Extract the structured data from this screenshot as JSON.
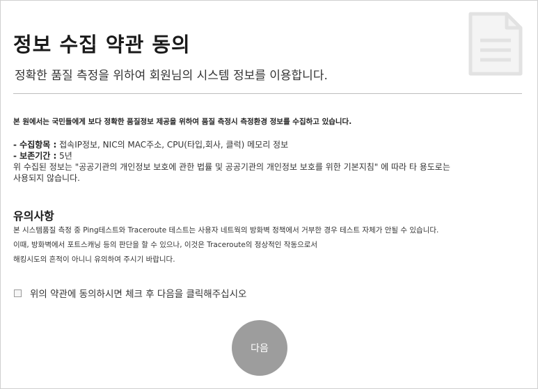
{
  "header": {
    "title": "정보 수집 약관 동의",
    "subtitle": "정확한 품질 측정을 위하여 회원님의 시스템 정보를 이용합니다."
  },
  "icons": {
    "document": "document-icon"
  },
  "intro": "본 원에서는 국민들에게 보다 정확한 품질정보 제공을 위하여 품질 측정시 측정환경 정보를 수집하고 있습니다.",
  "info": {
    "items_label": "- 수집항목 :",
    "items_value": " 접속IP정보, NIC의 MAC주소, CPU(타입,회사, 클럭) 메모리 정보",
    "period_label": "- 보존기간 :",
    "period_value": " 5년",
    "usage_line1": "위 수집된 정보는 \"공공기관의 개인정보 보호에 관한 법률 및 공공기관의 개인정보 보호를 위한 기본지침\" 에 따라 타 용도로는",
    "usage_line2": "사용되지 않습니다."
  },
  "caution": {
    "title": "유의사항",
    "line1": "본 시스템품질 측정 중 Ping테스트와 Traceroute 테스트는 사용자 네트웍의 방화벽 정책에서 거부한 경우 테스트 자체가 안될 수 있습니다.",
    "line2": "이때, 방화벽에서 포트스캐닝 등의 판단을 할 수 있으나, 이것은 Traceroute의 정상적인 작동으로서",
    "line3": "해킹시도의 흔적이 아니니 유의하여 주시기 바랍니다."
  },
  "agreement": {
    "label": "위의 약관에 동의하시면 체크 후 다음을 클릭해주십시오",
    "checked": false
  },
  "next_button": {
    "label": "다음",
    "color": "#9d9d9d"
  }
}
